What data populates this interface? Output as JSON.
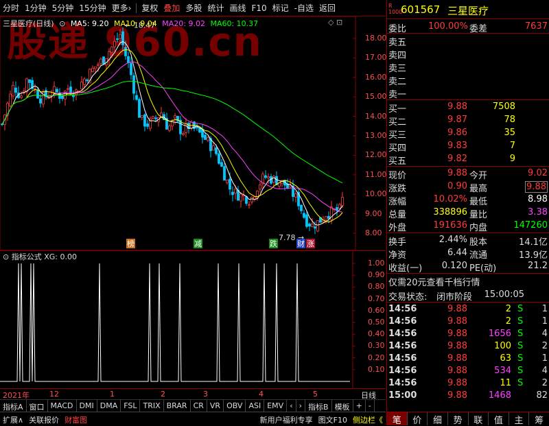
{
  "topbar": {
    "tabs": [
      "分时",
      "1分钟",
      "5分钟",
      "15分钟",
      "更多›",
      "复权",
      "叠加",
      "多股",
      "统计",
      "画线",
      "F10",
      "标记",
      "-自选",
      "返回"
    ],
    "active": "叠加"
  },
  "watermark": "股递 960.cn",
  "main_legend": {
    "title": "三星医疗(日线)",
    "ma5": "MA5: 9.20",
    "ma10": "MA10: 9.04",
    "ma20": "MA20: 9.02",
    "ma60": "MA60: 10.37"
  },
  "colors": {
    "up": "#ff3c3c",
    "down": "#00c8ff",
    "ma5": "#ffffff",
    "ma10": "#ffff00",
    "ma20": "#ff40ff",
    "ma60": "#00ff00",
    "axis": "#ff5050"
  },
  "annotations": {
    "high": "18.47",
    "low": "7.78"
  },
  "markers": [
    "榜",
    "减",
    "跌",
    "财",
    "涨"
  ],
  "y_axis": [
    "18.00",
    "17.00",
    "16.00",
    "15.00",
    "14.00",
    "13.00",
    "12.00",
    "11.00",
    "10.00",
    "9.00",
    "8.00"
  ],
  "indicator": {
    "title": "指标公式 XG: 0.00",
    "y_axis": [
      "1.00",
      "0.90",
      "0.80",
      "0.70",
      "0.60",
      "0.50",
      "0.40",
      "0.30",
      "0.20",
      "0.10"
    ],
    "spikes": [
      6,
      9,
      28,
      37,
      42,
      44,
      60,
      64,
      72,
      83,
      96
    ]
  },
  "x_axis": {
    "labels": [
      "2021年",
      "12",
      "1",
      "2",
      "3",
      "4",
      "5"
    ],
    "right": "日线"
  },
  "ind_tabs": [
    "指标A",
    "窗口",
    "MACD",
    "DMI",
    "DMA",
    "FSL",
    "TRIX",
    "BRAR",
    "CR",
    "VR",
    "OBV",
    "ASI",
    "EMV",
    "‹",
    "›",
    "指标B",
    "模板",
    "+",
    "-"
  ],
  "bottom": {
    "left": [
      "扩展∧",
      "关联报价",
      "财富图"
    ],
    "right": [
      "新用户福利专享",
      "图文F10",
      "侧边栏《"
    ]
  },
  "quote": {
    "code": "601567",
    "name": "三星医疗",
    "badge": "R",
    "badge2": "1000",
    "webi_label": "委比",
    "webi": "100.00%",
    "wecha_label": "委差",
    "wecha": "7637",
    "sell": [
      "卖五",
      "卖四",
      "卖三",
      "卖二",
      "卖一"
    ],
    "buy": [
      {
        "label": "买一",
        "price": "9.88",
        "vol": "7508"
      },
      {
        "label": "买二",
        "price": "9.87",
        "vol": "78"
      },
      {
        "label": "买三",
        "price": "9.86",
        "vol": "35"
      },
      {
        "label": "买四",
        "price": "9.83",
        "vol": "7"
      },
      {
        "label": "买五",
        "price": "9.82",
        "vol": "9"
      }
    ],
    "stats": [
      {
        "l1": "现价",
        "v1": "9.88",
        "l2": "今开",
        "v2": "9.02"
      },
      {
        "l1": "涨跌",
        "v1": "0.90",
        "l2": "最高",
        "v2": "9.88"
      },
      {
        "l1": "涨幅",
        "v1": "10.02%",
        "l2": "最低",
        "v2": "8.98"
      },
      {
        "l1": "总量",
        "v1": "338896",
        "l2": "量比",
        "v2": "3.38"
      },
      {
        "l1": "外盘",
        "v1": "191636",
        "l2": "内盘",
        "v2": "147260"
      }
    ],
    "stats2": [
      {
        "l1": "换手",
        "v1": "2.44%",
        "l2": "股本",
        "v2": "14.1亿"
      },
      {
        "l1": "净资",
        "v1": "6.44",
        "l2": "流通",
        "v2": "13.9亿"
      },
      {
        "l1": "收益(一)",
        "v1": "0.120",
        "l2": "PE(动)",
        "v2": "21.2"
      }
    ],
    "promo": "仅需20元查看千档行情",
    "status_label": "交易状态:",
    "status": "闭市阶段",
    "status_time": "15:00:05",
    "ticks": [
      {
        "t": "14:56",
        "p": "9.88",
        "v": "2",
        "s": "S",
        "n": "1"
      },
      {
        "t": "14:56",
        "p": "9.88",
        "v": "2",
        "s": "S",
        "n": "1"
      },
      {
        "t": "14:56",
        "p": "9.88",
        "v": "1656",
        "s": "S",
        "n": "4"
      },
      {
        "t": "14:56",
        "p": "9.88",
        "v": "100",
        "s": "S",
        "n": "2"
      },
      {
        "t": "14:56",
        "p": "9.88",
        "v": "63",
        "s": "S",
        "n": "1"
      },
      {
        "t": "14:56",
        "p": "9.88",
        "v": "534",
        "s": "S",
        "n": "4"
      },
      {
        "t": "14:56",
        "p": "9.88",
        "v": "11",
        "s": "S",
        "n": "2"
      },
      {
        "t": "15:00",
        "p": "9.88",
        "v": "1468",
        "s": "",
        "n": "82"
      }
    ],
    "tabs": [
      "笔",
      "价",
      "细",
      "势",
      "联",
      "值",
      "主",
      "筹"
    ]
  }
}
